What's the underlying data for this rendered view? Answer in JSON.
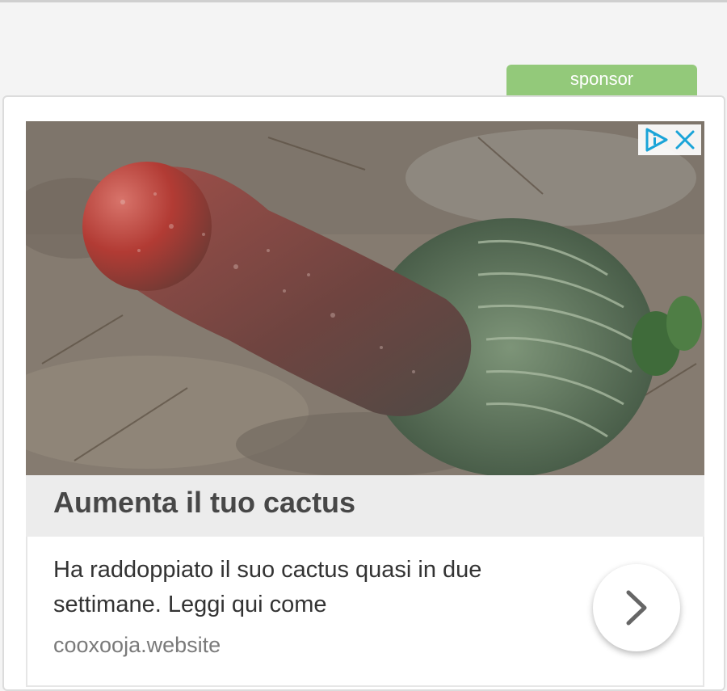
{
  "sponsor_label": "sponsor",
  "ad": {
    "headline": "Aumenta il tuo cactus",
    "description": "Ha raddoppiato il suo cactus quasi in due settimane. Leggi qui come",
    "domain": "cooxooja.website",
    "image_alt": "cactus",
    "icons": {
      "adchoices": "adchoices-icon",
      "close": "close-icon",
      "next": "chevron-right-icon"
    }
  },
  "colors": {
    "sponsor_tab": "#93c97a",
    "headline_band": "#ececec",
    "headline_text": "#474747",
    "adchoices_blue": "#1aa4d8"
  }
}
